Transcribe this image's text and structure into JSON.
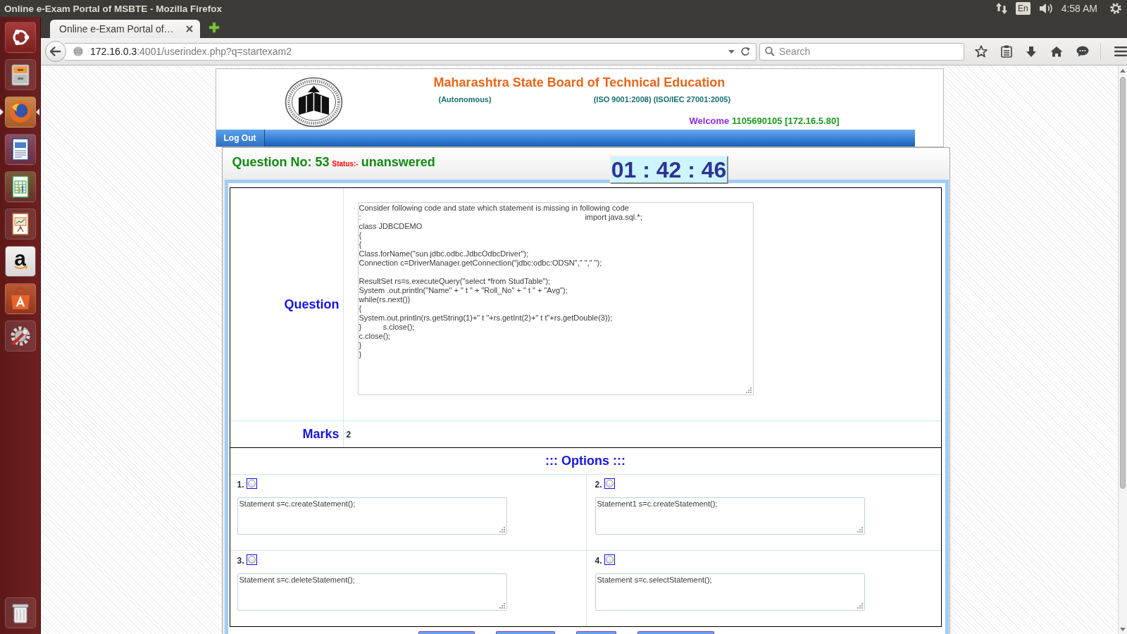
{
  "panel": {
    "window_title": "Online e-Exam Portal of MSBTE - Mozilla Firefox",
    "keyboard": "En",
    "clock": "4:58 AM"
  },
  "launcher": [
    {
      "kind": "dash",
      "active": false
    },
    {
      "kind": "files",
      "active": false
    },
    {
      "kind": "browser",
      "active": true
    },
    {
      "kind": "writer",
      "active": false
    },
    {
      "kind": "calc",
      "active": false
    },
    {
      "kind": "impress",
      "active": false
    },
    {
      "kind": "store",
      "active": false,
      "label": "a"
    },
    {
      "kind": "software",
      "active": false
    },
    {
      "kind": "settings",
      "active": false
    },
    {
      "kind": "trash",
      "active": false
    }
  ],
  "browser": {
    "tabs": [
      {
        "label": "Online e-Exam Portal of…",
        "selected": true
      }
    ],
    "address": {
      "host": "172.16.0.3",
      "rest": ":4001/userindex.php?q=startexam2"
    },
    "search": {
      "placeholder": "Search"
    }
  },
  "header": {
    "title": "Maharashtra State Board of Technical Education",
    "status_note": "(Autonomous)",
    "certification": "(ISO 9001:2008) (ISO/IEC 27001:2005)",
    "welcome_label": "Welcome",
    "user": "1105690105 [172.16.5.80]"
  },
  "logout_button": "Log Out",
  "question_bar": {
    "number": "Question No: 53",
    "status_label": "Status:-",
    "status": "unanswered",
    "timer": "01 : 42 : 46"
  },
  "question": {
    "label": "Question",
    "text": "Consider following code and state which statement is missing in following code\n:                                                                                                        import java.sql.*;\nclass JDBCDEMO\n{\n{\nClass.forName(\"sun.jdbc.odbc.JdbcOdbcDriver\");\nConnection c=DriverManager.getConnection(\"jdbc:odbc:ODSN\",\" \",\" \");\n\nResultSet rs=s.executeQuery(\"select *from StudTable\");\nSystem .out.println(\"Name\" + \" t \" + \"Roll_No\" + \" t \" + \"Avg\");\nwhile(rs.next())\n{\nSystem.out.println(rs.getString(1)+\" t \"+rs.getInt(2)+\" t t\"+rs.getDouble(3));\n}          s.close();\nc.close();\n}\n}"
  },
  "marks": {
    "label": "Marks",
    "value": "2"
  },
  "options": {
    "heading": "::: Options :::",
    "items": [
      {
        "number": "1.",
        "text": "Statement s=c.createStatement();",
        "selected": false
      },
      {
        "number": "2.",
        "text": "Statement1 s=c.createStatement();",
        "selected": false
      },
      {
        "number": "3.",
        "text": "Statement s=c.deleteStatement();",
        "selected": false
      },
      {
        "number": "4.",
        "text": "Statement s=c.selectStatement();",
        "selected": false
      }
    ]
  }
}
